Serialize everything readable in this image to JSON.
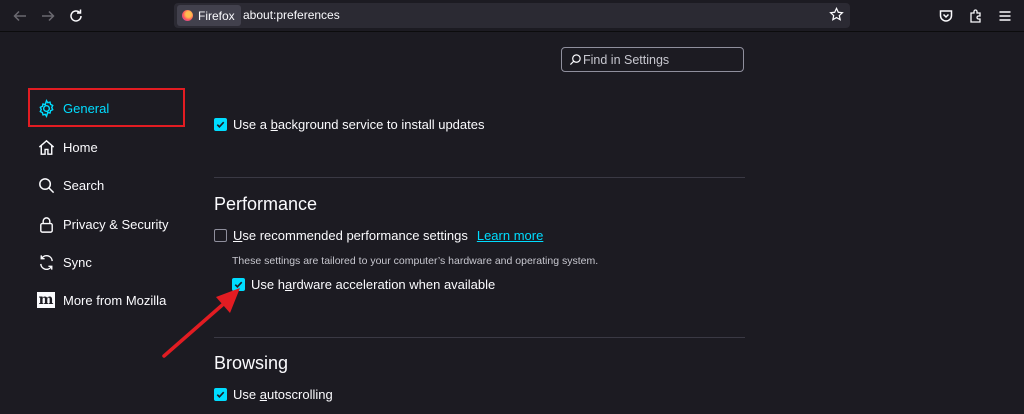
{
  "toolbar": {
    "identity_label": "Firefox",
    "url": "about:preferences"
  },
  "search": {
    "placeholder": "Find in Settings"
  },
  "sidebar": {
    "items": [
      {
        "label": "General",
        "icon": "gear-icon",
        "active": true
      },
      {
        "label": "Home",
        "icon": "home-icon"
      },
      {
        "label": "Search",
        "icon": "search-icon"
      },
      {
        "label": "Privacy & Security",
        "icon": "lock-icon"
      },
      {
        "label": "Sync",
        "icon": "sync-icon"
      },
      {
        "label": "More from Mozilla",
        "icon": "mozilla-icon",
        "glyph": "m"
      }
    ]
  },
  "general": {
    "background_updates": {
      "pre": "Use a ",
      "key": "b",
      "post": "ackground service to install updates",
      "checked": true
    }
  },
  "performance": {
    "title": "Performance",
    "recommended": {
      "pre": "",
      "key": "U",
      "post": "se recommended performance settings",
      "checked": false
    },
    "learn_more": "Learn more",
    "note": "These settings are tailored to your computer’s hardware and operating system.",
    "hardware_accel": {
      "pre": "Use h",
      "key": "a",
      "post": "rdware acceleration when available",
      "checked": true
    }
  },
  "browsing": {
    "title": "Browsing",
    "autoscroll": {
      "pre": "Use ",
      "key": "a",
      "post": "utoscrolling",
      "checked": true
    }
  },
  "colors": {
    "accent": "#00ddff",
    "annotation": "#e21c22",
    "background": "#1c1b22"
  }
}
